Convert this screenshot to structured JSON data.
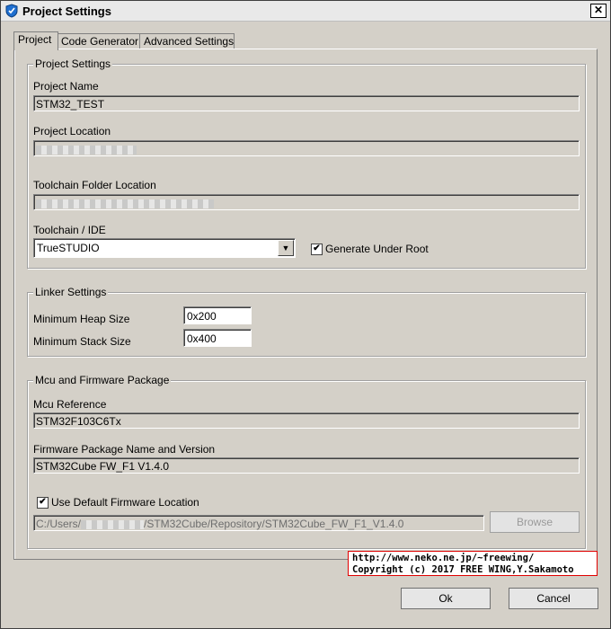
{
  "window": {
    "title": "Project Settings",
    "close_label": "✕"
  },
  "tabs": [
    {
      "label": "Project"
    },
    {
      "label": "Code Generator"
    },
    {
      "label": "Advanced Settings"
    }
  ],
  "project_settings": {
    "group_title": "Project Settings",
    "project_name_label": "Project Name",
    "project_name_value": "STM32_TEST",
    "project_location_label": "Project Location",
    "toolchain_folder_label": "Toolchain Folder Location",
    "toolchain_ide_label": "Toolchain / IDE",
    "toolchain_ide_value": "TrueSTUDIO",
    "generate_under_root_label": "Generate Under Root",
    "generate_under_root_checked": "✔"
  },
  "linker_settings": {
    "group_title": "Linker Settings",
    "min_heap_label": "Minimum Heap Size",
    "min_heap_value": "0x200",
    "min_stack_label": "Minimum Stack Size",
    "min_stack_value": "0x400"
  },
  "mcu_firmware": {
    "group_title": "Mcu and Firmware Package",
    "mcu_reference_label": "Mcu Reference",
    "mcu_reference_value": "STM32F103C6Tx",
    "firmware_package_label": "Firmware Package Name and Version",
    "firmware_package_value": "STM32Cube FW_F1 V1.4.0",
    "use_default_label": "Use Default Firmware Location",
    "use_default_checked": "✔",
    "firmware_path_prefix": "C:/Users/",
    "firmware_path_suffix": "/STM32Cube/Repository/STM32Cube_FW_F1_V1.4.0",
    "browse_label": "Browse"
  },
  "buttons": {
    "ok_label": "Ok",
    "cancel_label": "Cancel"
  },
  "watermark": {
    "line1": "http://www.neko.ne.jp/~freewing/",
    "line2": "Copyright (c) 2017 FREE WING,Y.Sakamoto"
  },
  "colors": {
    "dialog_bg": "#d4d0c8",
    "watermark_border": "#e00000",
    "shield_icon": "#1f6fd0"
  }
}
